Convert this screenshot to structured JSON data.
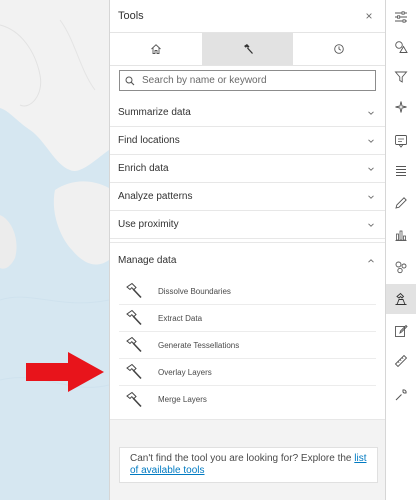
{
  "panel": {
    "title": "Tools",
    "close_label": "×"
  },
  "tabs": [
    {
      "icon": "home-icon",
      "active": false
    },
    {
      "icon": "hammer-icon",
      "active": true
    },
    {
      "icon": "history-icon",
      "active": false
    }
  ],
  "search": {
    "placeholder": "Search by name or keyword"
  },
  "sections": [
    {
      "label": "Summarize data",
      "expanded": false
    },
    {
      "label": "Find locations",
      "expanded": false
    },
    {
      "label": "Enrich data",
      "expanded": false
    },
    {
      "label": "Analyze patterns",
      "expanded": false
    },
    {
      "label": "Use proximity",
      "expanded": false
    }
  ],
  "manage": {
    "label": "Manage data",
    "expanded": true,
    "tools": [
      {
        "label": "Dissolve Boundaries"
      },
      {
        "label": "Extract Data"
      },
      {
        "label": "Generate Tessellations"
      },
      {
        "label": "Overlay Layers"
      },
      {
        "label": "Merge Layers"
      }
    ]
  },
  "help": {
    "text": "Can't find the tool you are looking for? Explore the ",
    "link": "list of available tools"
  },
  "rail": {
    "items": [
      {
        "icon": "sliders-icon"
      },
      {
        "icon": "shapes-icon"
      },
      {
        "icon": "filter-icon"
      },
      {
        "icon": "sparkle-icon"
      },
      {
        "icon": "popup-icon"
      },
      {
        "icon": "list-icon"
      },
      {
        "icon": "pencil-icon"
      },
      {
        "icon": "bar-chart-icon"
      },
      {
        "icon": "layers-icon"
      },
      {
        "icon": "analysis-tools-icon",
        "active": true
      },
      {
        "icon": "edit-box-icon"
      },
      {
        "icon": "ruler-icon"
      },
      {
        "icon": "wrench-icon"
      }
    ]
  },
  "colors": {
    "arrow": "#e8141b",
    "link": "#007ac2",
    "water": "#d9e9f2",
    "land": "#f2f2f2"
  }
}
